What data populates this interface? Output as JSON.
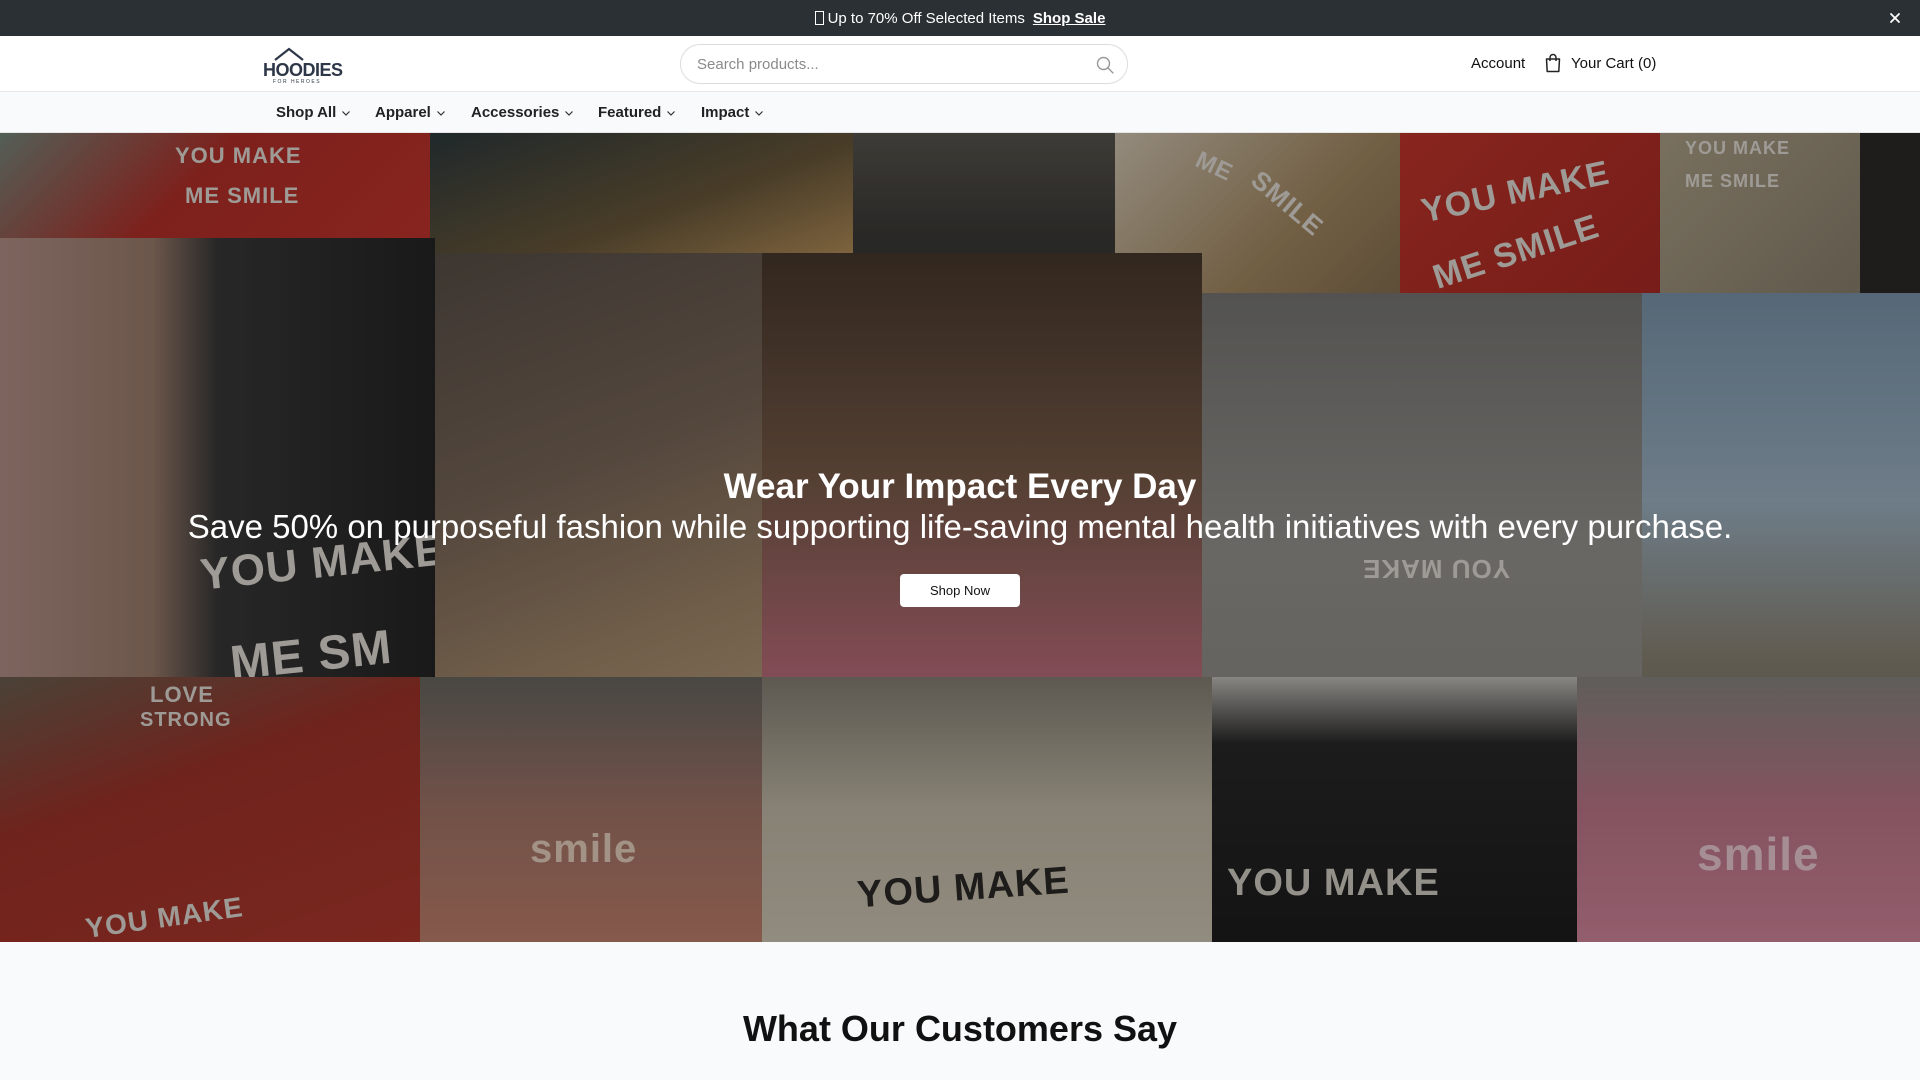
{
  "announcement": {
    "text": "Up to 70% Off Selected Items",
    "link": "Shop Sale"
  },
  "header": {
    "logo_text": "HOODIES",
    "logo_subtext": "FOR HEROES",
    "search_placeholder": "Search products...",
    "account_label": "Account",
    "cart_label": "Your Cart (0)"
  },
  "nav": {
    "items": [
      {
        "label": "Shop All"
      },
      {
        "label": "Apparel"
      },
      {
        "label": "Accessories"
      },
      {
        "label": "Featured"
      },
      {
        "label": "Impact"
      }
    ]
  },
  "hero": {
    "title": "Wear Your Impact Every Day",
    "subtitle": "Save 50% on purposeful fashion while supporting life-saving mental health initiatives with every purchase.",
    "button_label": "Shop Now",
    "photo_texts": {
      "t1a": "YOU MAKE",
      "t1b": "ME SMILE",
      "t8a": "ME",
      "t8b": "SMILE",
      "t9a": "YOU MAKE",
      "t9b": "ME SMILE",
      "t10a": "YOU MAKE",
      "t10b": "ME SMILE",
      "t11a": "YOU MAKE",
      "t11b": "ME SM",
      "t13": "YOU MAKE",
      "t15a": "LOVE",
      "t15b": "STRONG",
      "t15c": "YOU MAKE",
      "t16": "smile",
      "t17": "YOU MAKE",
      "t19": "YOU MAKE",
      "t20": "smile"
    }
  },
  "testimonials": {
    "heading": "What Our Customers Say"
  },
  "colors": {
    "announcement_bg": "#2a3033",
    "nav_bg": "#f8fafc",
    "section_bg": "#f8fafc"
  }
}
